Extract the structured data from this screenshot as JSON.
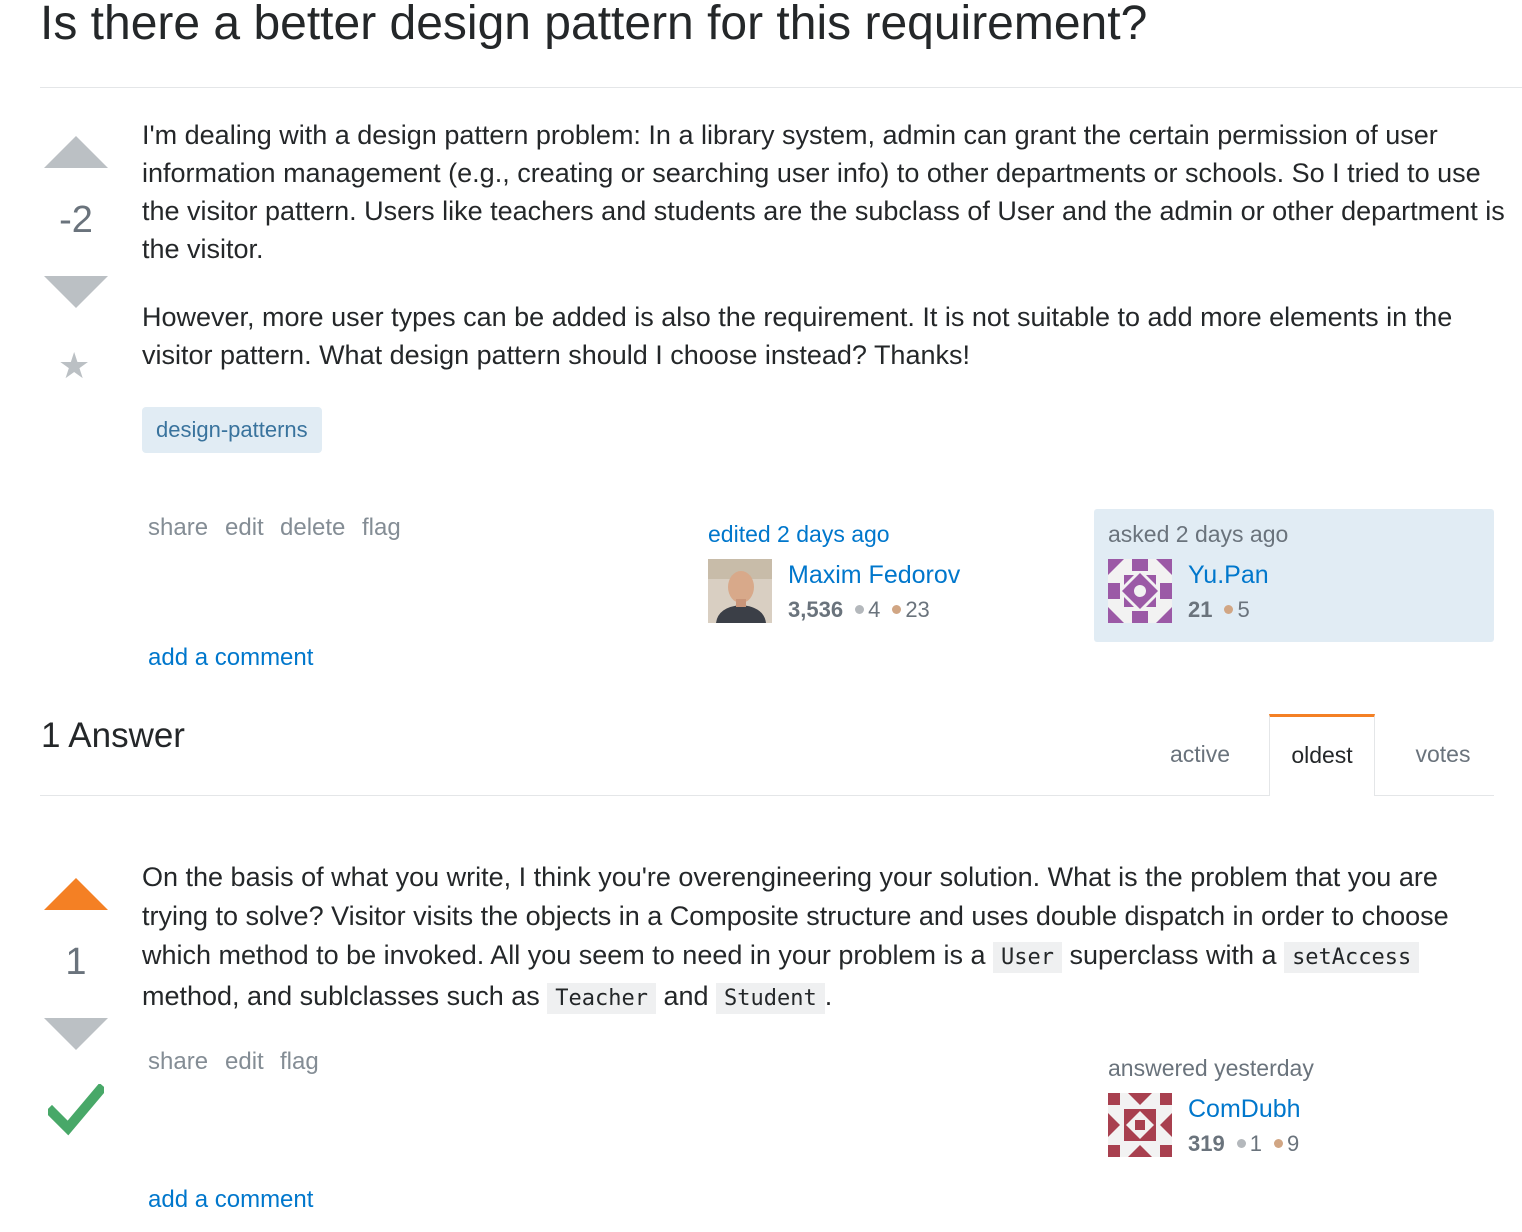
{
  "question": {
    "title": "Is there a better design pattern for this requirement?",
    "votes": "-2",
    "body": [
      "I'm dealing with a design pattern problem: In a library system, admin can grant the certain permission of user information management (e.g., creating or searching user info) to other departments or schools. So I tried to use the visitor pattern. Users like teachers and students are the subclass of User and the admin or other department is the visitor.",
      "However, more user types can be added is also the requirement. It is not suitable to add more elements in the visitor pattern. What design pattern should I choose instead? Thanks!"
    ],
    "tags": [
      "design-patterns"
    ],
    "menu": {
      "share": "share",
      "edit": "edit",
      "delete": "delete",
      "flag": "flag"
    },
    "edited": {
      "label": "edited 2 days ago",
      "user": "Maxim Fedorov",
      "rep": "3,536",
      "silver": "4",
      "bronze": "23"
    },
    "asked": {
      "label": "asked 2 days ago",
      "user": "Yu.Pan",
      "rep": "21",
      "bronze": "5"
    },
    "add_comment": "add a comment"
  },
  "answers_header": "1 Answer",
  "tabs": {
    "active": "active",
    "oldest": "oldest",
    "votes": "votes",
    "selected": "oldest"
  },
  "answer": {
    "votes": "1",
    "accepted": true,
    "body": {
      "t1": "On the basis of what you write, I think you're overengineering your solution. What is the problem that you are trying to solve? Visitor visits the objects in a Composite structure and uses double dispatch in order to choose which method to be invoked. All you seem to need in your problem is a ",
      "c1": "User",
      "t2": " superclass with a ",
      "c2": "setAccess",
      "t3": " method, and sublclasses such as ",
      "c3": "Teacher",
      "t4": " and ",
      "c4": "Student",
      "t5": "."
    },
    "menu": {
      "share": "share",
      "edit": "edit",
      "flag": "flag"
    },
    "answered": {
      "label": "answered yesterday",
      "user": "ComDubh",
      "rep": "319",
      "silver": "1",
      "bronze": "9"
    },
    "add_comment": "add a comment"
  },
  "colors": {
    "accent": "#f48024",
    "link": "#0077cc",
    "tag_bg": "#e1ecf4",
    "tag_text": "#39739d",
    "accepted": "#48a868",
    "vote_gray": "#bbc0c4"
  }
}
